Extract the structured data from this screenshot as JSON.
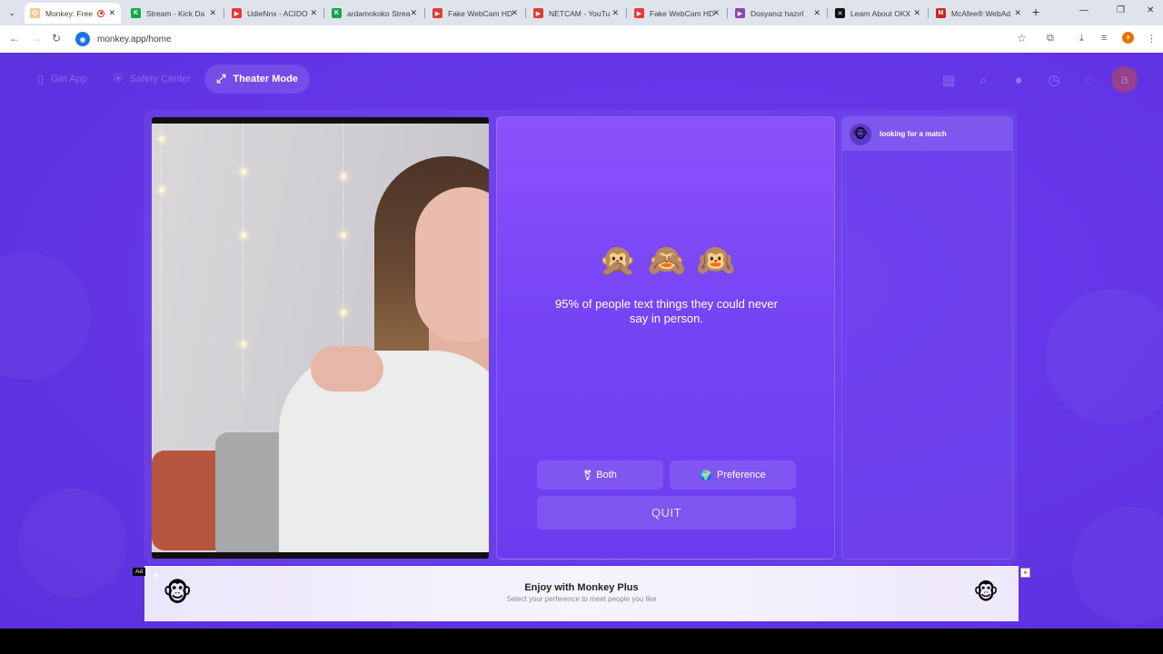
{
  "browser": {
    "tabs": [
      {
        "label": "Monkey: Free",
        "active": true,
        "fav_color": "#f0c890",
        "fav_glyph": "🐵",
        "recording": true
      },
      {
        "label": "Stream - Kick Da",
        "fav_color": "#16a34a",
        "fav_glyph": "K"
      },
      {
        "label": "UdieNnx - ACIDO",
        "fav_color": "#e53935",
        "fav_glyph": "▶"
      },
      {
        "label": "ardamokoko Strea",
        "fav_color": "#16a34a",
        "fav_glyph": "K"
      },
      {
        "label": "Fake WebCam HD",
        "fav_color": "#e53935",
        "fav_glyph": "▶"
      },
      {
        "label": "NETCAM - YouTu",
        "fav_color": "#e53935",
        "fav_glyph": "▶"
      },
      {
        "label": "Fake WebCam HD",
        "fav_color": "#e53935",
        "fav_glyph": "▶"
      },
      {
        "label": "Dosyanız hazırl",
        "fav_color": "#8e44ad",
        "fav_glyph": "▶"
      },
      {
        "label": "Learn About OKX",
        "fav_color": "#111111",
        "fav_glyph": "✕"
      },
      {
        "label": "McAfee® WebAd",
        "fav_color": "#c62828",
        "fav_glyph": "M"
      }
    ],
    "url": "monkey.app/home"
  },
  "header": {
    "get_app": "Get App",
    "safety_center": "Safety Center",
    "theater_mode": "Theater Mode",
    "avatar_letter": "a"
  },
  "center": {
    "monkeys": [
      "🙊",
      "🙈",
      "🙉"
    ],
    "tagline": "95% of people text things they could never say in person.",
    "both_label": "Both",
    "both_icon": "⚧",
    "preference_label": "Preference",
    "preference_icon": "🌍",
    "quit_label": "QUIT"
  },
  "chat": {
    "status": "looking for a match",
    "avatar": "🐵"
  },
  "ad": {
    "badge": "Ad",
    "title": "Enjoy with Monkey Plus",
    "subtitle": "Select your perference to meet people you like",
    "close": "×",
    "left_icon": "🐵",
    "right_icon": "🐵"
  },
  "colors": {
    "page_bg": "#6436e8",
    "panel_top": "#8a52fa",
    "panel_bottom": "#6b3cef"
  }
}
